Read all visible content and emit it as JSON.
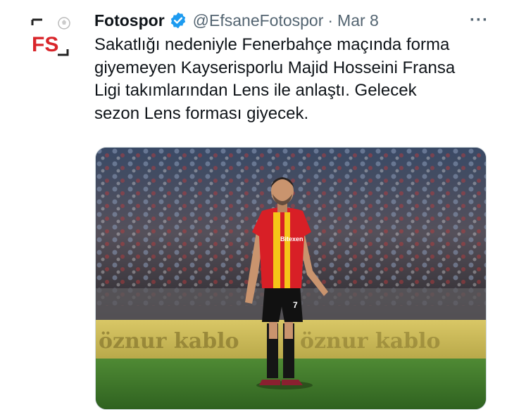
{
  "tweet": {
    "author_name": "Fotospor",
    "handle": "@EfsaneFotospor",
    "separator": "·",
    "date": "Mar 8",
    "more": "···",
    "text_lines": [
      "Sakatlığı nedeniyle Fenerbahçe maçında forma",
      "giyemeyen Kayserisporlu Majid Hosseini Fransa",
      "Ligi takımlarından Lens ile anlaştı. Gelecek",
      "sezon Lens forması giyecek."
    ],
    "avatar_letters": "FS",
    "media": {
      "banner_text": "öznur kablo",
      "jersey_sponsor": "Bitexen",
      "shorts_number": "7"
    }
  },
  "colors": {
    "verified": "#1d9bf0",
    "logo_red": "#d9252a",
    "jersey_red": "#d81f26",
    "jersey_yellow": "#f5c518",
    "pitch": "#3e7a28"
  },
  "icons": {
    "verified": "verified-badge-icon",
    "more": "more-options-icon"
  }
}
